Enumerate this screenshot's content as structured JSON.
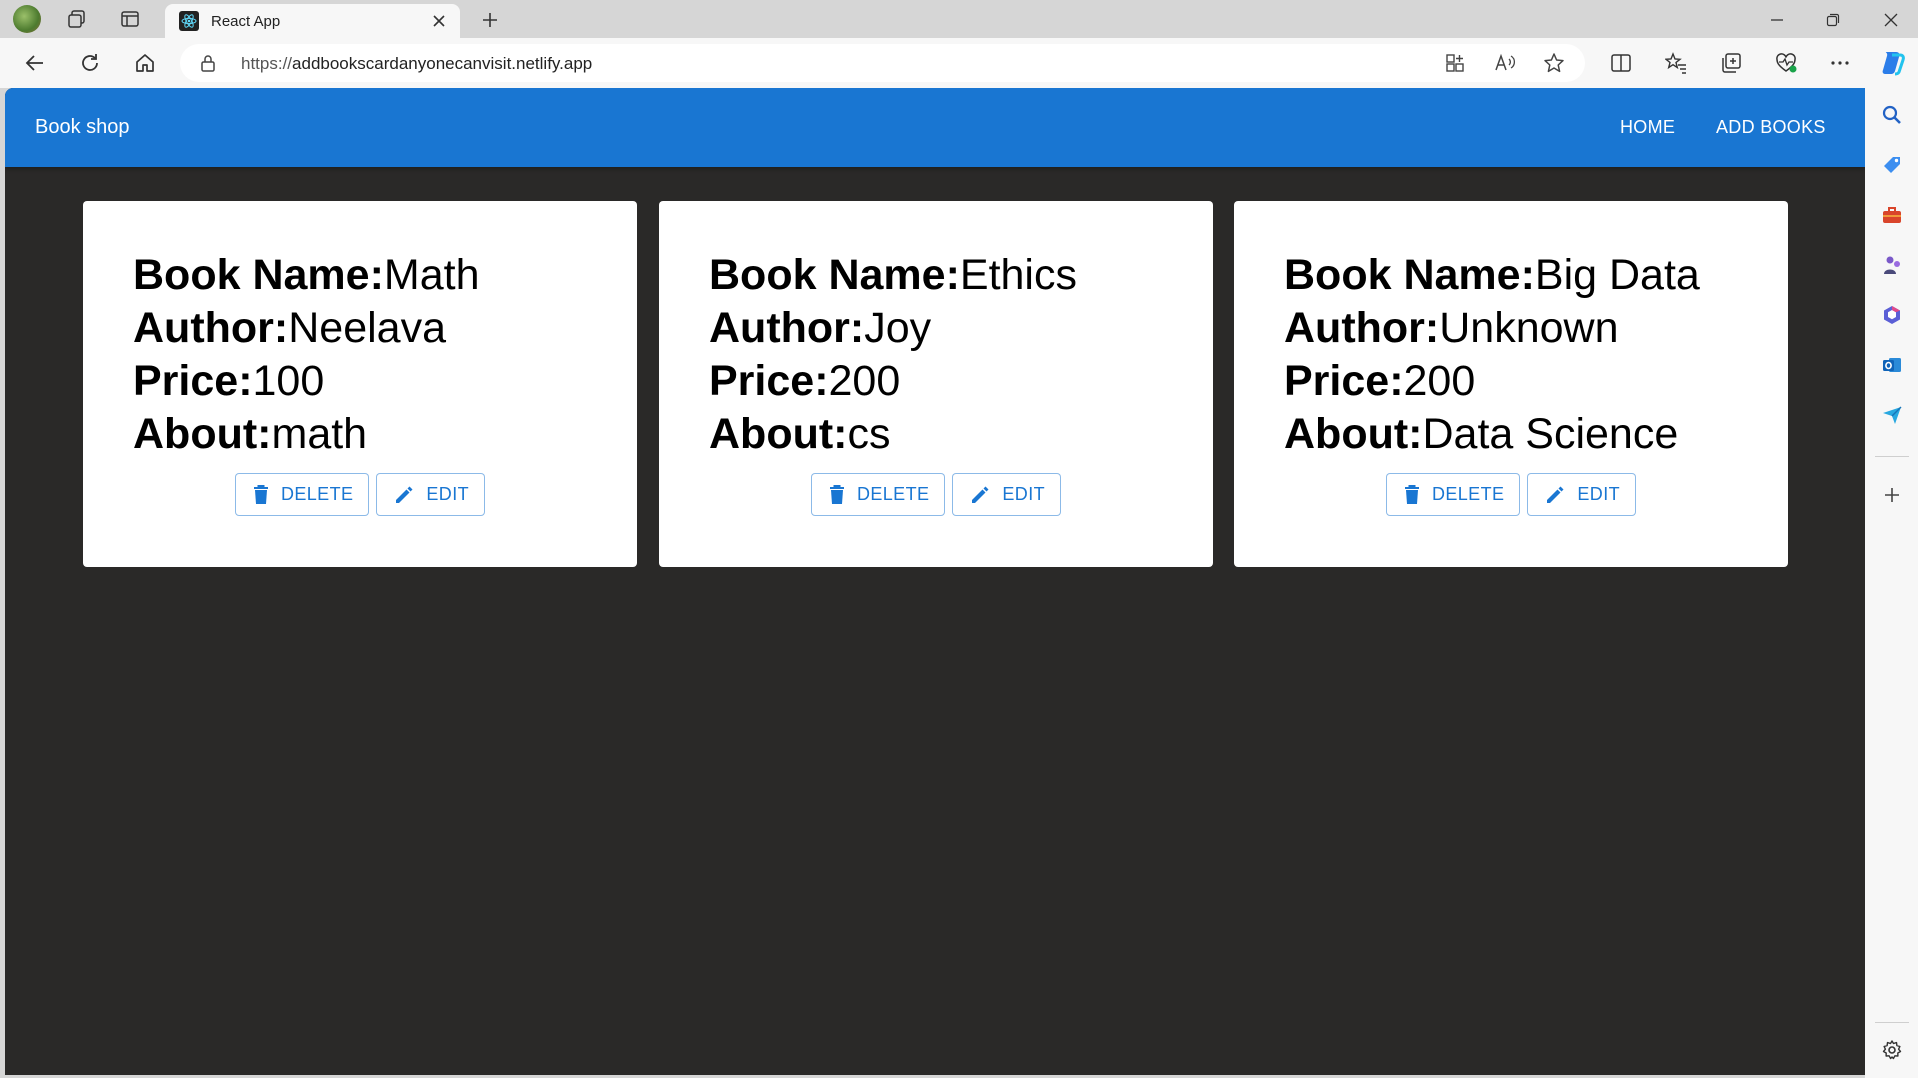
{
  "browser": {
    "tab_title": "React App",
    "url_protocol": "https://",
    "url_host": "addbookscardanyonecanvisit.netlify.app"
  },
  "app": {
    "brand": "Book shop",
    "nav": [
      {
        "label": "HOME"
      },
      {
        "label": "ADD BOOKS"
      }
    ],
    "field_labels": {
      "name": "Book Name:",
      "author": "Author:",
      "price": "Price:",
      "about": "About:"
    },
    "buttons": {
      "delete": "DELETE",
      "edit": "EDIT"
    },
    "books": [
      {
        "name": "Math",
        "author": "Neelava",
        "price": "100",
        "about": "math"
      },
      {
        "name": "Ethics",
        "author": "Joy",
        "price": "200",
        "about": "cs"
      },
      {
        "name": "Big Data",
        "author": "Unknown",
        "price": "200",
        "about": "Data Science"
      }
    ]
  },
  "colors": {
    "appbar": "#1976d2",
    "page_background": "#2a2928",
    "card": "#ffffff"
  }
}
